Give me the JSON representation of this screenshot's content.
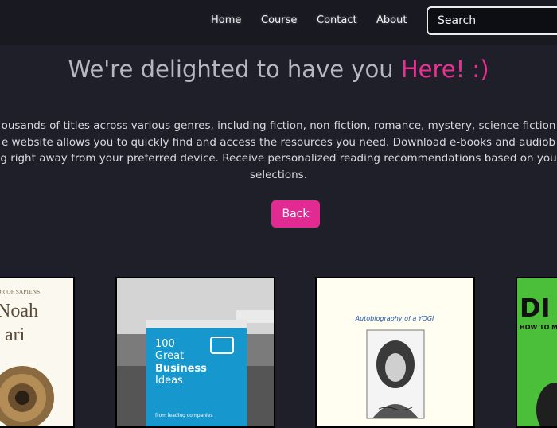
{
  "nav": {
    "links": [
      "Home",
      "Course",
      "Contact",
      "About"
    ],
    "search_placeholder": "Search"
  },
  "hero": {
    "title": "We're delighted to have you",
    "title_accent": "Here! :)",
    "description_lines": [
      "ousands of titles across various genres, including fiction, non-fiction, romance, mystery, science fiction",
      "e website allows you to quickly find and access the resources you need. Download e-books and audiob",
      "g right away from your preferred device. Receive personalized reading recommendations based on you",
      "selections."
    ],
    "back_label": "Back"
  },
  "books": [
    {
      "cover_lines": [
        "OR OF SAPIENS",
        "Noah",
        "ari"
      ]
    },
    {
      "cover_lines": [
        "100",
        "Great",
        "Business",
        "Ideas",
        "from leading companies"
      ]
    },
    {
      "cover_lines": [
        "Autobiography of a YOGI"
      ]
    },
    {
      "cover_lines": [
        "DI",
        "HOW TO MA"
      ]
    }
  ],
  "colors": {
    "accent": "#ec2f95",
    "button": "#e12b93",
    "background": "#1e1f29",
    "navbar": "#181921"
  }
}
